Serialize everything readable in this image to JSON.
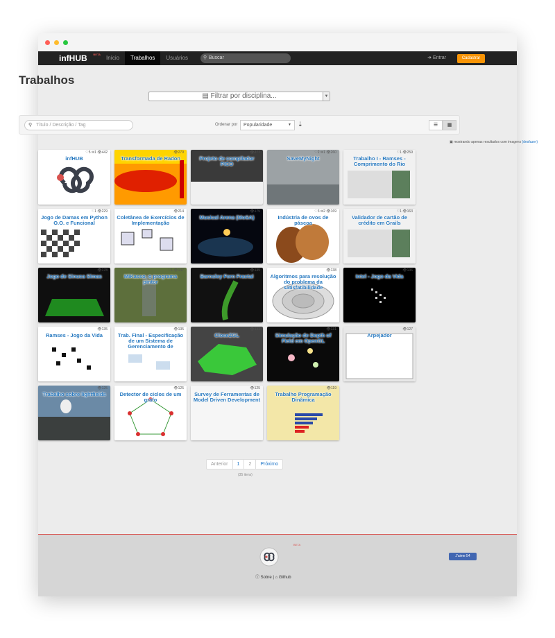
{
  "nav": {
    "brand": "infHUB",
    "brand_badge": "BETA",
    "items": [
      "Início",
      "Trabalhos",
      "Usuários"
    ],
    "search_placeholder": "Buscar",
    "login": "Entrar",
    "signup": "Cadastrar"
  },
  "page": {
    "title": "Trabalhos",
    "filter_placeholder": "Filtrar por disciplina...",
    "search_placeholder": "Título / Descrição / Tag",
    "order_label": "Ordenar por",
    "order_value": "Popularidade",
    "note": "mostrando apenas resultados com imagens",
    "note_link": "(desfazer)"
  },
  "works": [
    {
      "title": "infHUB",
      "likes": "5",
      "comments": "1",
      "views": "442",
      "theme": "logo"
    },
    {
      "title": "Transformada de Radon",
      "likes": "",
      "comments": "",
      "views": "279",
      "theme": "heat"
    },
    {
      "title": "Projeto de compilador PICO",
      "likes": "",
      "comments": "",
      "views": "277",
      "theme": "code"
    },
    {
      "title": "SaveMyNight",
      "likes": "2",
      "comments": "1",
      "views": "260",
      "theme": "save"
    },
    {
      "title": "Trabalho I - Ramses - Comprimento do Rio",
      "likes": "1",
      "comments": "",
      "views": "259",
      "theme": "table"
    },
    {
      "title": "Jogo de Damas em Python O.O. e Funcional",
      "likes": "1",
      "comments": "",
      "views": "229",
      "theme": "checkers"
    },
    {
      "title": "Coletânea de Exercícios de Implementação",
      "likes": "",
      "comments": "",
      "views": "214",
      "theme": "diagram"
    },
    {
      "title": "Musical Arena (MoSA)",
      "likes": "",
      "comments": "",
      "views": "175",
      "theme": "space"
    },
    {
      "title": "Indústria de ovos de páscoa",
      "likes": "3",
      "comments": "2",
      "views": "169",
      "theme": "eggs"
    },
    {
      "title": "Validador de cartão de crédito em Grails",
      "likes": "1",
      "comments": "",
      "views": "163",
      "theme": "table"
    },
    {
      "title": "Jogo de Sinuca Simas",
      "likes": "",
      "comments": "",
      "views": "178",
      "theme": "pool"
    },
    {
      "title": "MiKasso, o programa pintor",
      "likes": "1",
      "comments": "",
      "views": "147",
      "theme": "forest"
    },
    {
      "title": "Barnsley Fern Fractal",
      "likes": "",
      "comments": "",
      "views": "135",
      "theme": "fern"
    },
    {
      "title": "Algoritmos para resolução do problema da satisfatibilidade",
      "likes": "",
      "comments": "",
      "views": "138",
      "theme": "rings"
    },
    {
      "title": "Intel - Jogo da Vida",
      "likes": "",
      "comments": "",
      "views": "136",
      "theme": "life"
    },
    {
      "title": "Ramses - Jogo da Vida",
      "likes": "",
      "comments": "",
      "views": "135",
      "theme": "grid"
    },
    {
      "title": "Trab. Final - Especificação de um Sistema de Gerenciamento de",
      "likes": "",
      "comments": "",
      "views": "135",
      "theme": "uml"
    },
    {
      "title": "CloseZGL",
      "likes": "",
      "comments": "",
      "views": "132",
      "theme": "poly"
    },
    {
      "title": "Simulação de Depth of Field em OpenGL",
      "likes": "",
      "comments": "",
      "views": "131",
      "theme": "bokeh"
    },
    {
      "title": "Arpejador",
      "likes": "",
      "comments": "",
      "views": "127",
      "theme": "app"
    },
    {
      "title": "Trabalho sobre lightfields",
      "likes": "",
      "comments": "",
      "views": "125",
      "theme": "bird"
    },
    {
      "title": "Detector de ciclos de um grafo",
      "likes": "",
      "comments": "",
      "views": "125",
      "theme": "graph"
    },
    {
      "title": "Survey de Ferramentas de Model Driven Development",
      "likes": "",
      "comments": "",
      "views": "125",
      "theme": "blank"
    },
    {
      "title": "Trabalho Programação Dinâmica",
      "likes": "",
      "comments": "",
      "views": "119",
      "theme": "hist"
    }
  ],
  "pagination": {
    "prev": "Anterior",
    "pages": [
      "1",
      "2"
    ],
    "next": "Próximo",
    "total": "(35 itens)"
  },
  "footer": {
    "links": [
      "Sobre",
      "Github"
    ],
    "like": "J'aime 54",
    "badge": "BETA"
  },
  "colors": {
    "accent": "#f89406",
    "link": "#2a7bc1",
    "navbar": "#222222"
  }
}
